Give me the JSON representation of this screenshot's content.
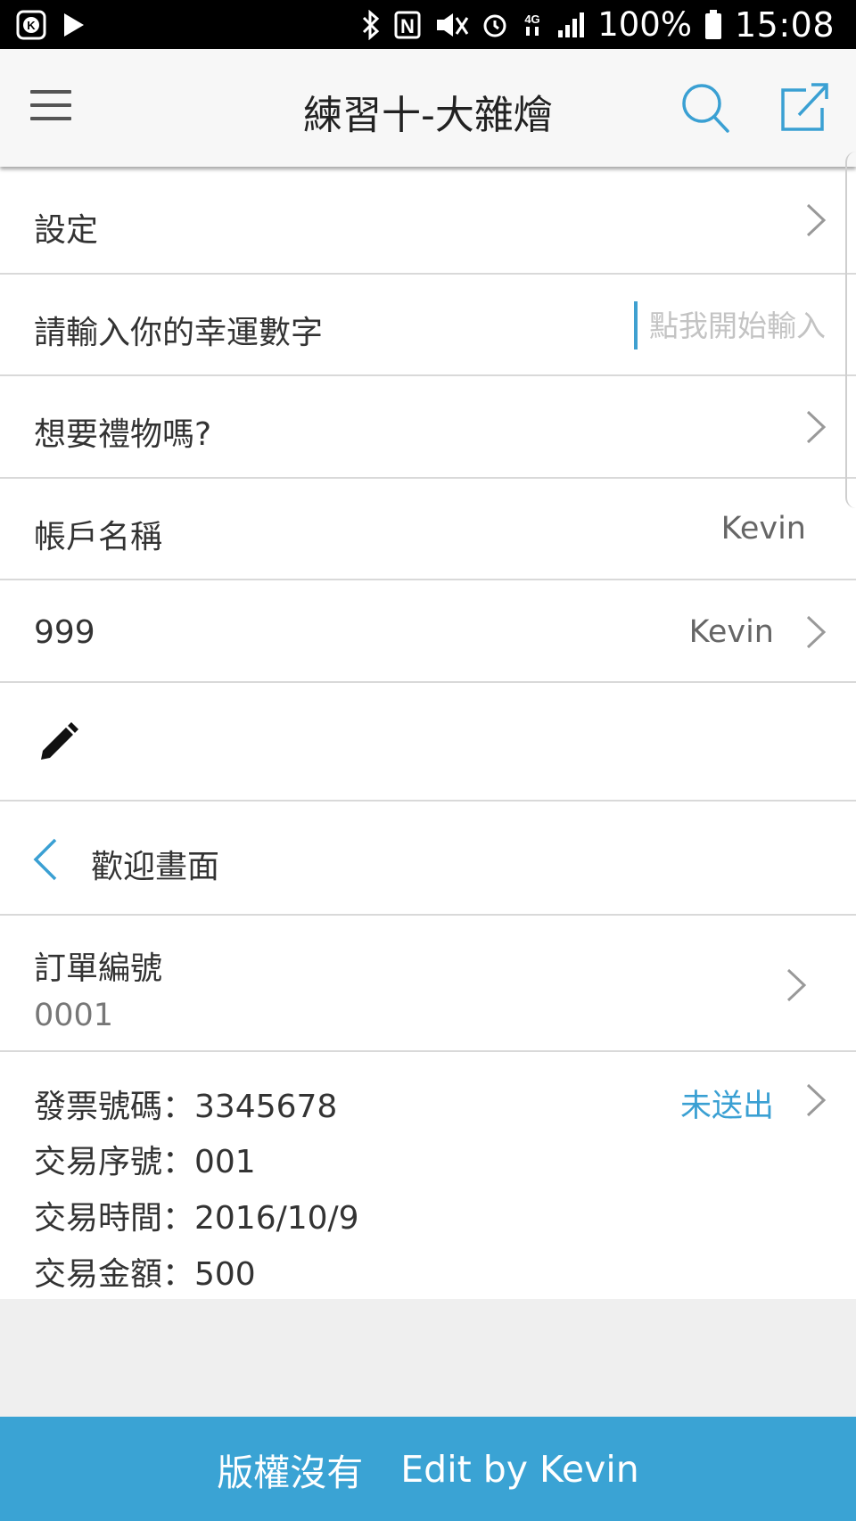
{
  "status_bar": {
    "battery_percent": "100%",
    "time": "15:08",
    "network": "4G",
    "icons": [
      "k-app-icon",
      "play-icon",
      "bluetooth-icon",
      "nfc-icon",
      "mute-icon",
      "alarm-icon",
      "4g-icon",
      "signal-icon",
      "battery-icon"
    ]
  },
  "app_bar": {
    "title": "練習十-大雜燴",
    "accent_color": "#3aa0d3"
  },
  "rows": {
    "settings": {
      "label": "設定"
    },
    "lucky_number": {
      "label": "請輸入你的幸運數字",
      "placeholder": "點我開始輸入",
      "value": ""
    },
    "gift": {
      "label": "想要禮物嗎?"
    },
    "account": {
      "label": "帳戶名稱",
      "value": "Kevin"
    },
    "custom": {
      "label": "999",
      "value": "Kevin"
    },
    "back": {
      "label": "歡迎畫面"
    },
    "order": {
      "label": "訂單編號",
      "value": "0001"
    },
    "invoice": {
      "invoice_no": "發票號碼：3345678",
      "serial": "交易序號：001",
      "time": "交易時間：2016/10/9",
      "amount": "交易金額：500",
      "status": "未送出"
    }
  },
  "footer": {
    "copyright": "版權沒有",
    "edit_by": "Edit by Kevin",
    "color": "#3aa3d4"
  }
}
